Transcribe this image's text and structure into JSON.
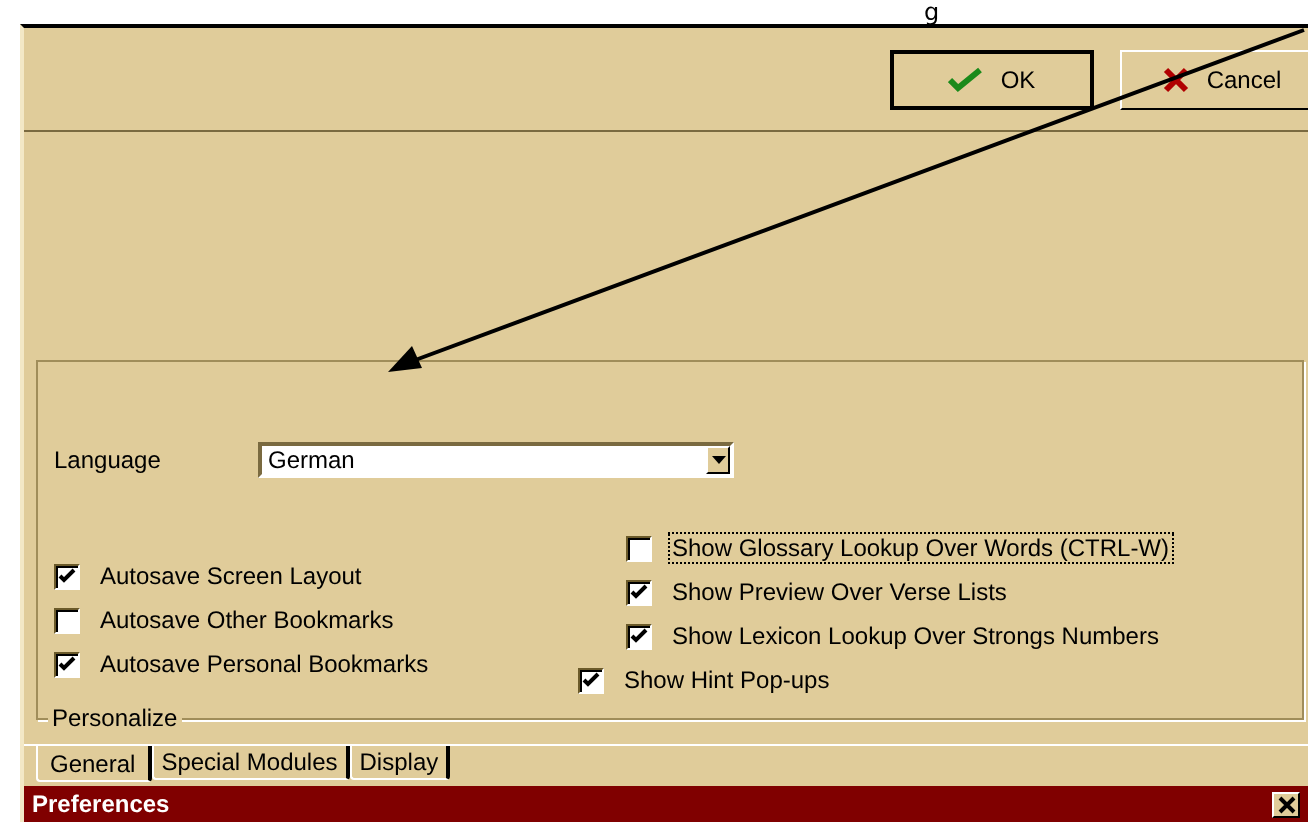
{
  "caption": "g",
  "window": {
    "title": "Preferences"
  },
  "tabs": [
    {
      "label": "General",
      "selected": true
    },
    {
      "label": "Special Modules",
      "selected": false
    },
    {
      "label": "Display",
      "selected": false
    }
  ],
  "group": {
    "title": "Personalize",
    "left_options": [
      {
        "label": "Autosave Screen Layout",
        "checked": true
      },
      {
        "label": "Autosave Other Bookmarks",
        "checked": false
      },
      {
        "label": "Autosave Personal Bookmarks",
        "checked": true
      }
    ],
    "right_options": [
      {
        "label": "Show Hint Pop-ups",
        "checked": true,
        "focused": false,
        "children": [
          {
            "label": "Show Glossary Lookup Over Words (CTRL-W)",
            "checked": false,
            "focused": true
          },
          {
            "label": "Show Preview Over Verse Lists",
            "checked": true,
            "focused": false
          },
          {
            "label": "Show Lexicon Lookup Over Strongs Numbers",
            "checked": true,
            "focused": false
          }
        ]
      }
    ],
    "language": {
      "label": "Language",
      "value": "German"
    }
  },
  "buttons": [
    {
      "label": "OK",
      "kind": "ok"
    },
    {
      "label": "Cancel",
      "kind": "cancel"
    }
  ]
}
